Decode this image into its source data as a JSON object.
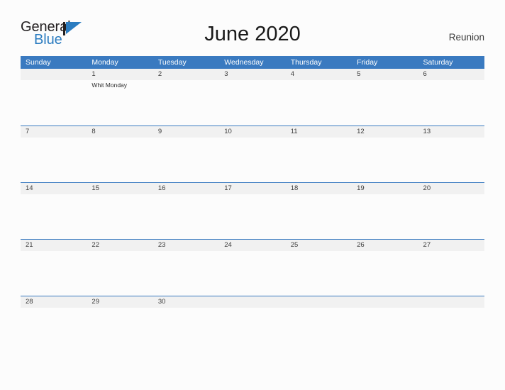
{
  "brand": {
    "name_part1": "General",
    "name_part2": "Blue",
    "mark_icon": "triangle-flag-icon",
    "color_primary": "#2b7cc0",
    "color_text": "#231f20"
  },
  "header": {
    "title": "June 2020",
    "region": "Reunion"
  },
  "calendar": {
    "accent_color": "#3a7ac0",
    "day_band_color": "#f1f1f1",
    "weekdays": [
      "Sunday",
      "Monday",
      "Tuesday",
      "Wednesday",
      "Thursday",
      "Friday",
      "Saturday"
    ],
    "weeks": [
      {
        "days": [
          {
            "num": "",
            "events": []
          },
          {
            "num": "1",
            "events": [
              "Whit Monday"
            ]
          },
          {
            "num": "2",
            "events": []
          },
          {
            "num": "3",
            "events": []
          },
          {
            "num": "4",
            "events": []
          },
          {
            "num": "5",
            "events": []
          },
          {
            "num": "6",
            "events": []
          }
        ]
      },
      {
        "days": [
          {
            "num": "7",
            "events": []
          },
          {
            "num": "8",
            "events": []
          },
          {
            "num": "9",
            "events": []
          },
          {
            "num": "10",
            "events": []
          },
          {
            "num": "11",
            "events": []
          },
          {
            "num": "12",
            "events": []
          },
          {
            "num": "13",
            "events": []
          }
        ]
      },
      {
        "days": [
          {
            "num": "14",
            "events": []
          },
          {
            "num": "15",
            "events": []
          },
          {
            "num": "16",
            "events": []
          },
          {
            "num": "17",
            "events": []
          },
          {
            "num": "18",
            "events": []
          },
          {
            "num": "19",
            "events": []
          },
          {
            "num": "20",
            "events": []
          }
        ]
      },
      {
        "days": [
          {
            "num": "21",
            "events": []
          },
          {
            "num": "22",
            "events": []
          },
          {
            "num": "23",
            "events": []
          },
          {
            "num": "24",
            "events": []
          },
          {
            "num": "25",
            "events": []
          },
          {
            "num": "26",
            "events": []
          },
          {
            "num": "27",
            "events": []
          }
        ]
      },
      {
        "days": [
          {
            "num": "28",
            "events": []
          },
          {
            "num": "29",
            "events": []
          },
          {
            "num": "30",
            "events": []
          },
          {
            "num": "",
            "events": []
          },
          {
            "num": "",
            "events": []
          },
          {
            "num": "",
            "events": []
          },
          {
            "num": "",
            "events": []
          }
        ]
      }
    ]
  }
}
